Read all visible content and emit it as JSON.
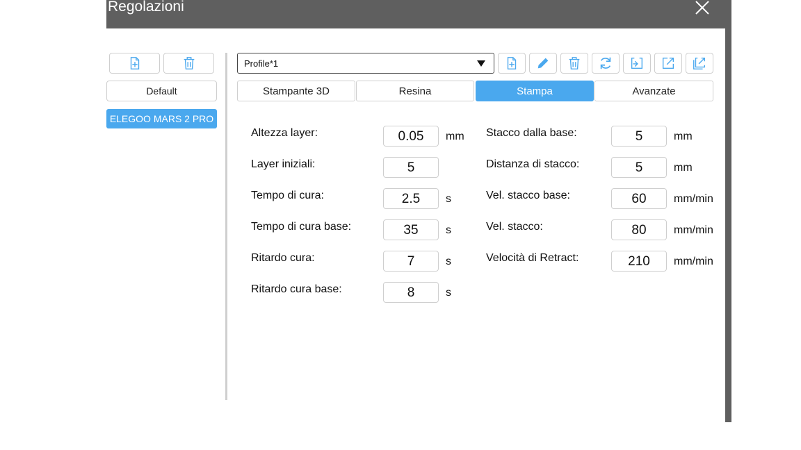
{
  "window": {
    "title": "Regolazioni"
  },
  "left_panel": {
    "default_label": "Default",
    "printer": "ELEGOO MARS 2 PRO"
  },
  "profile": {
    "selected": "Profile*1"
  },
  "tabs": [
    {
      "label": "Stampante 3D"
    },
    {
      "label": "Resina"
    },
    {
      "label": "Stampa",
      "active": true
    },
    {
      "label": "Avanzate"
    }
  ],
  "left_params": [
    {
      "label": "Altezza layer:",
      "value": "0.05",
      "unit": "mm"
    },
    {
      "label": "Layer iniziali:",
      "value": "5",
      "unit": ""
    },
    {
      "label": "Tempo di cura:",
      "value": "2.5",
      "unit": "s"
    },
    {
      "label": "Tempo di cura base:",
      "value": "35",
      "unit": "s"
    },
    {
      "label": "Ritardo cura:",
      "value": "7",
      "unit": "s"
    },
    {
      "label": "Ritardo cura base:",
      "value": "8",
      "unit": "s"
    }
  ],
  "right_params": [
    {
      "label": "Stacco dalla base:",
      "value": "5",
      "unit": "mm"
    },
    {
      "label": "Distanza di stacco:",
      "value": "5",
      "unit": "mm"
    },
    {
      "label": "Vel. stacco base:",
      "value": "60",
      "unit": "mm/min"
    },
    {
      "label": "Vel. stacco:",
      "value": "80",
      "unit": "mm/min"
    },
    {
      "label": "Velocità di Retract:",
      "value": "210",
      "unit": "mm/min"
    }
  ],
  "colors": {
    "titlebar": "#5f5f5f",
    "accent": "#4aa8ee",
    "icon": "#4aa8ee"
  }
}
